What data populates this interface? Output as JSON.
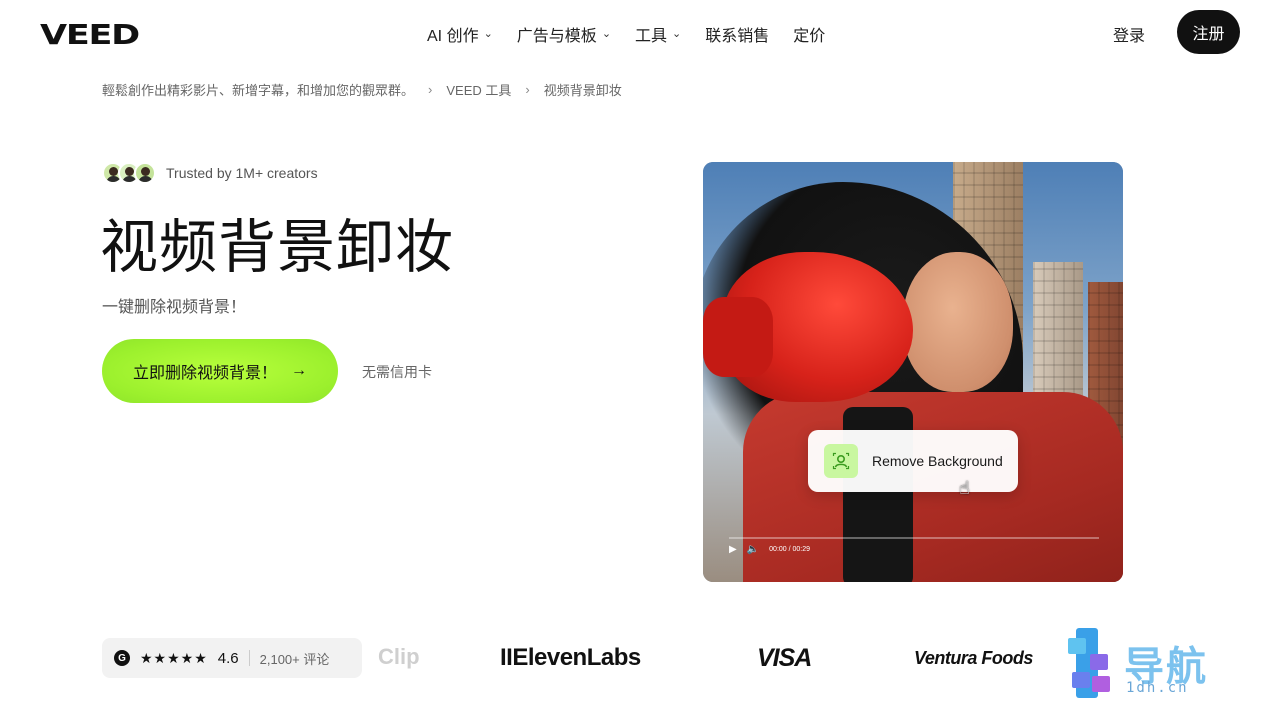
{
  "nav": {
    "logo": "VEED",
    "menu": [
      {
        "label": "AI 创作",
        "has_chevron": true
      },
      {
        "label": "广告与模板",
        "has_chevron": true
      },
      {
        "label": "工具",
        "has_chevron": true
      },
      {
        "label": "联系销售",
        "has_chevron": false
      },
      {
        "label": "定价",
        "has_chevron": false
      }
    ],
    "login": "登录",
    "signup": "注册"
  },
  "breadcrumb": {
    "items": [
      "輕鬆創作出精彩影片、新增字幕，和增加您的觀眾群。",
      "VEED 工具",
      "视频背景卸妆"
    ],
    "separator": "›"
  },
  "hero": {
    "trusted": "Trusted by 1M+ creators",
    "title": "视频背景卸妆",
    "subtitle": "一键删除视频背景！",
    "cta": "立即删除视频背景！",
    "cta_arrow": "→",
    "no_credit_card": "无需信用卡"
  },
  "video": {
    "remove_background": "Remove Background",
    "time": "00:00 / 00:29",
    "progress": 0
  },
  "rating": {
    "stars": "★★★★★",
    "score": "4.6",
    "reviews": "2,100+ 评论"
  },
  "brands": {
    "clip": "Clip",
    "elevenlabs": "IIElevenLabs",
    "visa": "VISA",
    "ventura": "Ventura Foods"
  },
  "watermark": {
    "text": "导航",
    "url": "1dh.cn"
  },
  "colors": {
    "cta": "#a6f33a",
    "signup_bg": "#111111",
    "icon_bg": "#c9f7a0"
  }
}
